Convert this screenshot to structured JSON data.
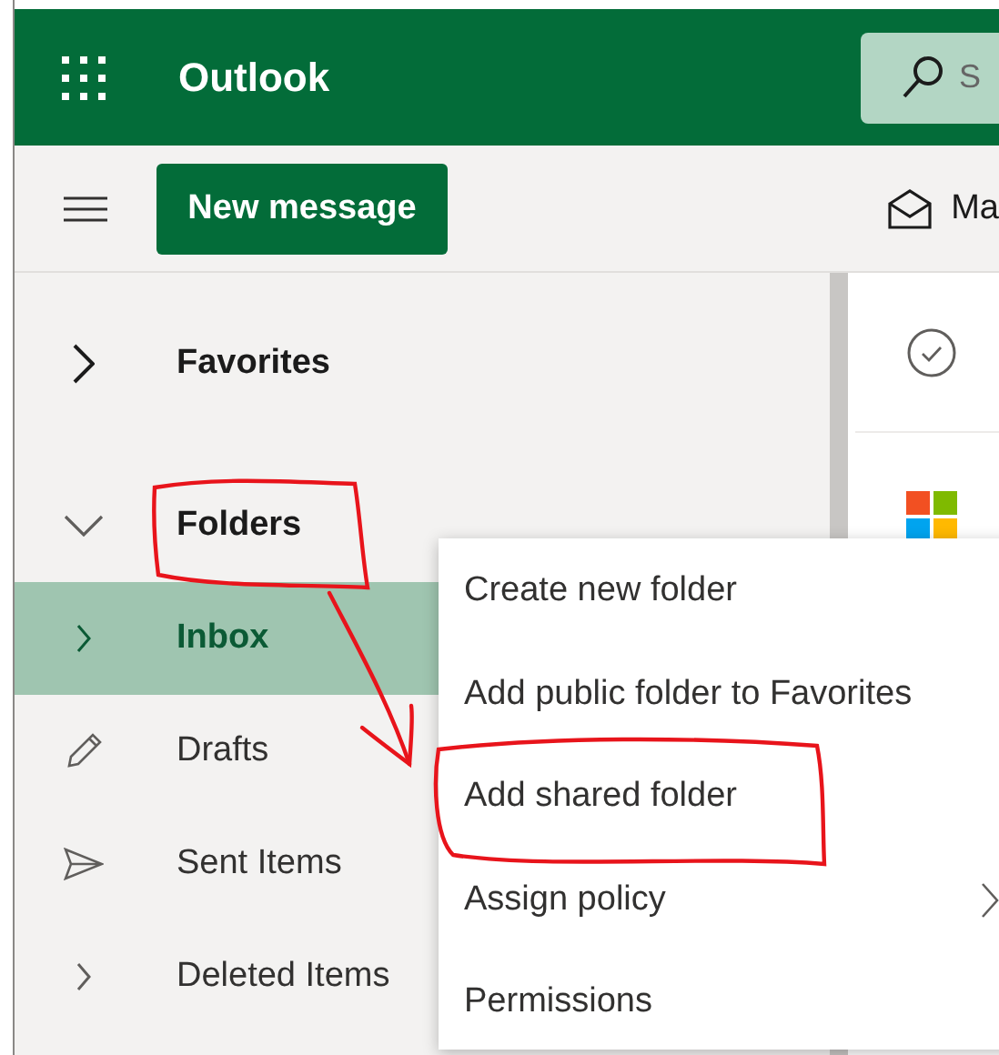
{
  "header": {
    "app_title": "Outlook",
    "search": {
      "placeholder": "S"
    }
  },
  "toolbar": {
    "new_message": "New message",
    "action": "Ma"
  },
  "nav": [
    {
      "kind": "section",
      "label": "Favorites",
      "expanded": false,
      "selected": false
    },
    {
      "kind": "section",
      "label": "Folders",
      "expanded": true,
      "selected": false
    },
    {
      "kind": "expandable",
      "label": "Inbox",
      "selected": true
    },
    {
      "kind": "draft",
      "label": "Drafts",
      "selected": false
    },
    {
      "kind": "sent",
      "label": "Sent Items",
      "selected": false
    },
    {
      "kind": "expandable",
      "label": "Deleted Items",
      "selected": false
    }
  ],
  "context_menu": [
    {
      "label": "Create new folder",
      "has_submenu": false
    },
    {
      "label": "Add public folder to Favorites",
      "has_submenu": false
    },
    {
      "label": "Add shared folder",
      "has_submenu": false
    },
    {
      "label": "Assign policy",
      "has_submenu": true
    },
    {
      "label": "Permissions",
      "has_submenu": false
    }
  ]
}
